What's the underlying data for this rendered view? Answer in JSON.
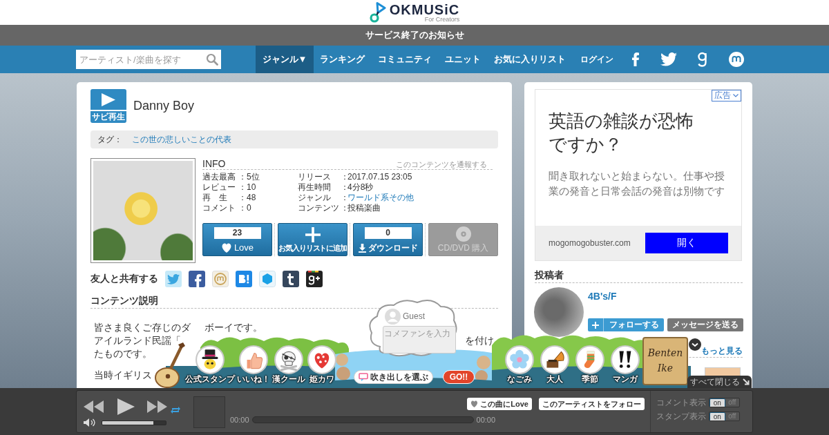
{
  "header": {
    "logo_name": "OKMUSiC",
    "logo_tagline": "For Creators"
  },
  "notice": {
    "text": "サービス終了のお知らせ"
  },
  "nav": {
    "search": {
      "placeholder": "アーティスト/楽曲を探す"
    },
    "items": [
      {
        "label": "ジャンル▼",
        "selected": true
      },
      {
        "label": "ランキング",
        "selected": false
      },
      {
        "label": "コミュニティ",
        "selected": false
      },
      {
        "label": "ユニット",
        "selected": false
      },
      {
        "label": "お気に入りリスト",
        "selected": false
      }
    ],
    "login": "ログイン"
  },
  "song": {
    "preview_label": "サビ再生",
    "title": "Danny Boy",
    "tag_label": "タグ：",
    "tags": [
      "この世の悲しいことの代表"
    ]
  },
  "info": {
    "heading": "INFO",
    "report_link": "このコンテンツを通報する",
    "columns": [
      [
        {
          "label": "過去最高",
          "separator": "：",
          "value": "5位",
          "link": false
        },
        {
          "label": "レビュー",
          "separator": "：",
          "value": "10",
          "link": false
        },
        {
          "label": "再　生",
          "separator": "：",
          "value": "48",
          "link": false
        },
        {
          "label": "コメント",
          "separator": "：",
          "value": "0",
          "link": false
        }
      ],
      [
        {
          "label": "リリース",
          "separator": "：",
          "value": "2017.07.15 23:05",
          "link": false
        },
        {
          "label": "再生時間",
          "separator": "：",
          "value": "4分8秒",
          "link": false
        },
        {
          "label": "ジャンル",
          "separator": "：",
          "value": "ワールド系その他",
          "link": true
        },
        {
          "label": "コンテンツ",
          "separator": "：",
          "value": "投稿楽曲",
          "link": false
        }
      ]
    ]
  },
  "actions": [
    {
      "kind": "love",
      "count": "23",
      "label": "Love",
      "disabled": false
    },
    {
      "kind": "favorite",
      "label": "お気入りリストに追加",
      "disabled": false
    },
    {
      "kind": "download",
      "count": "0",
      "label": "ダウンロード",
      "disabled": false
    },
    {
      "kind": "purchase",
      "label": "CD/DVD 購入",
      "disabled": true
    }
  ],
  "share": {
    "label": "友人と共有する"
  },
  "description": {
    "heading": "コンテンツ説明",
    "paragraphs": [
      [
        [
          "皆さま良くご存じのダ",
          "ボーイです。"
        ],
        [
          "アイルランド民謡「",
          "を付け"
        ],
        [
          "たものです。"
        ]
      ],
      [
        [
          "当時イギリス"
        ]
      ]
    ]
  },
  "ad": {
    "badge": "広告",
    "headline": "英語の雑談が恐怖ですか？",
    "body": "聞き取れないと始まらない。仕事や授業の発音と日常会話の発音は別物です",
    "domain": "mogomogobuster.com",
    "button": "開く"
  },
  "poster": {
    "heading": "投稿者",
    "name": "4B's/F",
    "follow_button": "フォローする",
    "message_button": "メッセージを送る",
    "more_link": "もっと見る"
  },
  "stamp_bar": {
    "left_stamps": [
      {
        "kind": "official",
        "label": "公式スタンプ"
      },
      {
        "kind": "like",
        "label": "いいね！"
      },
      {
        "kind": "cool",
        "label": "漢クール"
      },
      {
        "kind": "cute",
        "label": "姫カワ"
      }
    ],
    "comment": {
      "user": "Guest",
      "placeholder": "コメファンを入力",
      "bubble_button": "吹き出しを選ぶ",
      "submit": "GO!!"
    },
    "right_stamps": [
      {
        "kind": "calm",
        "label": "なごみ"
      },
      {
        "kind": "adult",
        "label": "大人"
      },
      {
        "kind": "season",
        "label": "季節"
      },
      {
        "kind": "manga",
        "label": "マンガ"
      }
    ],
    "sign": "Benten Ike",
    "close_all": "すべて閉じる"
  },
  "player": {
    "volume": {
      "level": 0.8
    },
    "love_button": "この曲にLove",
    "follow_button": "このアーティストをフォロー",
    "time_elapsed": "00:00",
    "time_total": "00:00",
    "toggles": [
      {
        "label": "コメント表示",
        "on_text": "on",
        "off_text": "off",
        "on": true
      },
      {
        "label": "スタンプ表示",
        "on_text": "on",
        "off_text": "off",
        "on": true
      }
    ]
  }
}
